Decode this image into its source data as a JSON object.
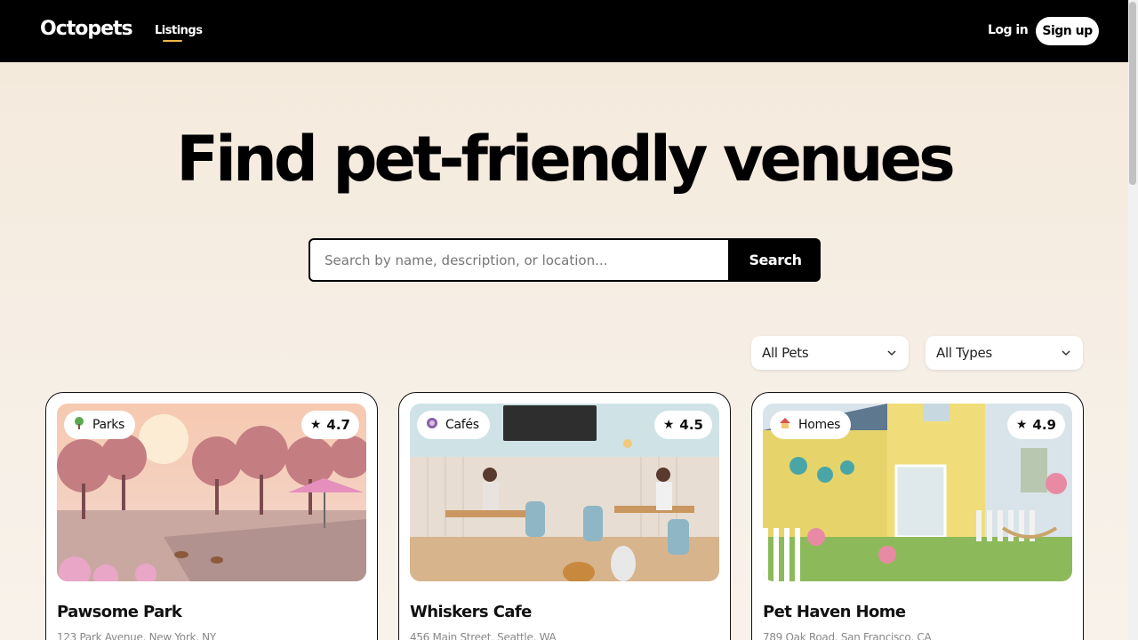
{
  "header": {
    "logo": "Octopets",
    "nav_listings": "Listings",
    "login": "Log in",
    "signup": "Sign up"
  },
  "hero": {
    "title": "Find pet-friendly venues"
  },
  "search": {
    "placeholder": "Search by name, description, or location...",
    "value": "",
    "button": "Search"
  },
  "filters": {
    "pets": "All Pets",
    "types": "All Types"
  },
  "listings": [
    {
      "category": "Parks",
      "category_icon": "tree-icon",
      "rating": "4.7",
      "title": "Pawsome Park",
      "address": "123 Park Avenue, New York, NY"
    },
    {
      "category": "Cafés",
      "category_icon": "coffee-icon",
      "rating": "4.5",
      "title": "Whiskers Cafe",
      "address": "456 Main Street, Seattle, WA"
    },
    {
      "category": "Homes",
      "category_icon": "house-icon",
      "rating": "4.9",
      "title": "Pet Haven Home",
      "address": "789 Oak Road, San Francisco, CA"
    }
  ],
  "colors": {
    "nav_bg": "#000000",
    "accent_underline": "#f0b84a",
    "page_bg": "#f4e9da"
  }
}
